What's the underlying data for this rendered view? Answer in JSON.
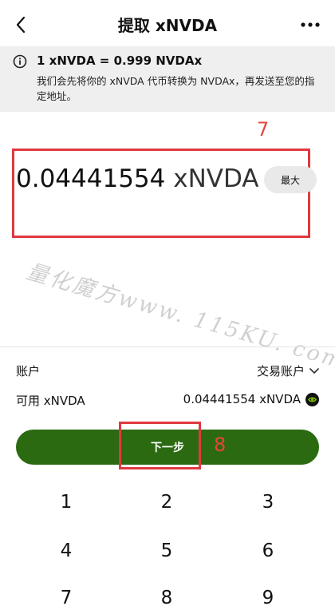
{
  "header": {
    "title": "提取 xNVDA"
  },
  "info": {
    "title": "1 xNVDA = 0.999 NVDAx",
    "description": "我们会先将你的 xNVDA 代币转换为 NVDAx，再发送至您的指定地址。"
  },
  "annotations": {
    "amount_box": "7",
    "next_box": "8"
  },
  "amount": {
    "value": "0.04441554",
    "unit": "xNVDA",
    "max_label": "最大"
  },
  "watermark": "量化魔方www. 115KU. com",
  "account": {
    "label": "账户",
    "value": "交易账户"
  },
  "available": {
    "label": "可用 xNVDA",
    "value": "0.04441554 xNVDA"
  },
  "next_button": "下一步",
  "keypad": [
    "1",
    "2",
    "3",
    "4",
    "5",
    "6",
    "7",
    "8",
    "9"
  ],
  "colors": {
    "primary": "#2b6a11",
    "annotation": "#e0393e",
    "nvidia": "#76b900"
  }
}
